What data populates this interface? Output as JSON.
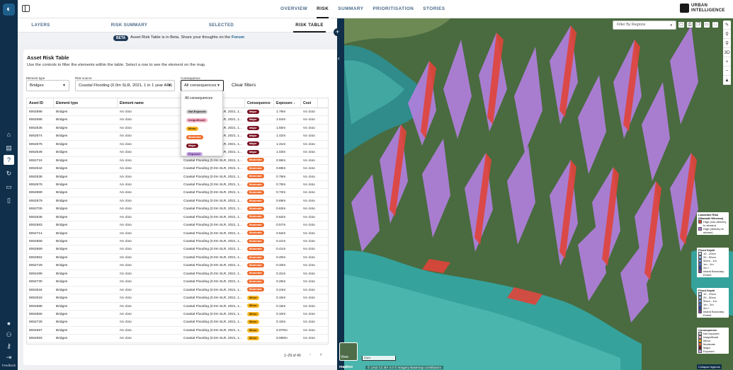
{
  "nav": {
    "items": [
      {
        "label": "OVERVIEW",
        "active": false
      },
      {
        "label": "RISK",
        "active": true
      },
      {
        "label": "SUMMARY",
        "active": false
      },
      {
        "label": "PRIORITISATION",
        "active": false
      },
      {
        "label": "STORIES",
        "active": false
      }
    ],
    "brand_line1": "URBAN",
    "brand_line2": "INTELLIGENCE"
  },
  "subtabs": [
    {
      "label": "LAYERS",
      "active": false
    },
    {
      "label": "RISK SUMMARY",
      "active": false
    },
    {
      "label": "SELECTED",
      "active": false
    },
    {
      "label": "RISK TABLE",
      "active": true
    }
  ],
  "beta": {
    "badge": "BETA",
    "message": "Asset Risk Table is in Beta. Share your thoughts on the ",
    "link": "Forum"
  },
  "card": {
    "title": "Asset Risk Table",
    "description": "Use the controls to filter the elements within the table. Select a row to see the element on the map."
  },
  "filters": {
    "element_type_label": "Element type",
    "element_type_value": "Bridges",
    "risk_source_label": "Risk source",
    "risk_source_value": "Coastal Flooding (0.0m SLR, 2021, 1 in 1 year ARI)",
    "consequence_label": "Consequence",
    "consequence_value": "All consequences",
    "clear_label": "Clear filters"
  },
  "dropdown": {
    "options": [
      "All consequences",
      "Not Exposed",
      "Insignificant",
      "Minor",
      "Moderate",
      "Major",
      "Exposed"
    ]
  },
  "table": {
    "headers": [
      "Asset ID",
      "Element type",
      "Element name",
      "Risk source",
      "Consequence",
      "Exposure ↓",
      "Cost"
    ],
    "rows": [
      [
        "6062598",
        "Bridges",
        "No data",
        "Coastal Flooding (0.0m SLR, 2021, 1...",
        "Major",
        "1.79m",
        "No data"
      ],
      [
        "6062695",
        "Bridges",
        "No data",
        "Coastal Flooding (0.0m SLR, 2021, 1...",
        "Major",
        "1.64m",
        "No data"
      ],
      [
        "6062535",
        "Bridges",
        "No data",
        "Coastal Flooding (0.0m SLR, 2021, 1...",
        "Major",
        "1.55m",
        "No data"
      ],
      [
        "6062674",
        "Bridges",
        "No data",
        "Coastal Flooding (0.0m SLR, 2021, 1...",
        "Major",
        "1.42m",
        "No data"
      ],
      [
        "6062675",
        "Bridges",
        "No data",
        "Coastal Flooding (0.0m SLR, 2021, 1...",
        "Major",
        "1.31m",
        "No data"
      ],
      [
        "6062539",
        "Bridges",
        "No data",
        "Coastal Flooding (0.0m SLR, 2021, 1...",
        "Major",
        "1.03m",
        "No data"
      ],
      [
        "6062724",
        "Bridges",
        "No data",
        "Coastal Flooding (0.0m SLR, 2021, 1...",
        "Moderate",
        "0.96m",
        "No data"
      ],
      [
        "6062542",
        "Bridges",
        "No data",
        "Coastal Flooding (0.0m SLR, 2021, 1...",
        "Moderate",
        "0.88m",
        "No data"
      ],
      [
        "6062538",
        "Bridges",
        "No data",
        "Coastal Flooding (0.0m SLR, 2021, 1...",
        "Moderate",
        "0.79m",
        "No data"
      ],
      [
        "6062678",
        "Bridges",
        "No data",
        "Coastal Flooding (0.0m SLR, 2021, 1...",
        "Moderate",
        "0.76m",
        "No data"
      ],
      [
        "6062689",
        "Bridges",
        "No data",
        "Coastal Flooding (0.0m SLR, 2021, 1...",
        "Moderate",
        "0.73m",
        "No data"
      ],
      [
        "6062679",
        "Bridges",
        "No data",
        "Coastal Flooding (0.0m SLR, 2021, 1...",
        "Moderate",
        "0.69m",
        "No data"
      ],
      [
        "6062705",
        "Bridges",
        "No data",
        "Coastal Flooding (0.0m SLR, 2021, 1...",
        "Moderate",
        "0.63m",
        "No data"
      ],
      [
        "6062536",
        "Bridges",
        "No data",
        "Coastal Flooding (0.0m SLR, 2021, 1...",
        "Moderate",
        "0.62m",
        "No data"
      ],
      [
        "6062683",
        "Bridges",
        "No data",
        "Coastal Flooding (0.0m SLR, 2021, 1...",
        "Moderate",
        "0.57m",
        "No data"
      ],
      [
        "6062714",
        "Bridges",
        "No data",
        "Coastal Flooding (0.0m SLR, 2021, 1...",
        "Moderate",
        "0.52m",
        "No data"
      ],
      [
        "6062658",
        "Bridges",
        "No data",
        "Coastal Flooding (0.0m SLR, 2021, 1...",
        "Moderate",
        "0.41m",
        "No data"
      ],
      [
        "6062659",
        "Bridges",
        "No data",
        "Coastal Flooding (0.0m SLR, 2021, 1...",
        "Moderate",
        "0.41m",
        "No data"
      ],
      [
        "6062662",
        "Bridges",
        "No data",
        "Coastal Flooding (0.0m SLR, 2021, 1...",
        "Moderate",
        "0.40m",
        "No data"
      ],
      [
        "6062729",
        "Bridges",
        "No data",
        "Coastal Flooding (0.0m SLR, 2021, 1...",
        "Moderate",
        "0.33m",
        "No data"
      ],
      [
        "6062489",
        "Bridges",
        "No data",
        "Coastal Flooding (0.0m SLR, 2021, 1...",
        "Moderate",
        "0.31m",
        "No data"
      ],
      [
        "6062730",
        "Bridges",
        "No data",
        "Coastal Flooding (0.0m SLR, 2021, 1...",
        "Moderate",
        "0.26m",
        "No data"
      ],
      [
        "6062534",
        "Bridges",
        "No data",
        "Coastal Flooding (0.0m SLR, 2021, 1...",
        "Moderate",
        "0.24m",
        "No data"
      ],
      [
        "6062518",
        "Bridges",
        "No data",
        "Coastal Flooding (0.0m SLR, 2021, 1...",
        "Minor",
        "0.15m",
        "No data"
      ],
      [
        "6062688",
        "Bridges",
        "No data",
        "Coastal Flooding (0.0m SLR, 2021, 1...",
        "Minor",
        "0.15m",
        "No data"
      ],
      [
        "6062656",
        "Bridges",
        "No data",
        "Coastal Flooding (0.0m SLR, 2021, 1...",
        "Minor",
        "0.10m",
        "No data"
      ],
      [
        "6062728",
        "Bridges",
        "No data",
        "Coastal Flooding (0.0m SLR, 2021, 1...",
        "Minor",
        "0.10m",
        "No data"
      ],
      [
        "6062597",
        "Bridges",
        "No data",
        "Coastal Flooding (0.0m SLR, 2021, 1...",
        "Minor",
        "0.070m",
        "No data"
      ],
      [
        "6062593",
        "Bridges",
        "No data",
        "Coastal Flooding (0.0m SLR, 2021, 1...",
        "Minor",
        "0.060m",
        "No data"
      ]
    ],
    "pagination": "1–29 of 40"
  },
  "map": {
    "filter_placeholder": "Filter By Regions",
    "mode_3d": "3D",
    "view_label": "View",
    "scale": "3 km",
    "mapbox": "mapbox",
    "attribution": "© LINZ CC BY 4.0 © Imagery Basemap contributors",
    "collapse_legends": "Collapse legends",
    "legends": [
      {
        "title": "Landslide Risk (Manaaki Whenua)",
        "items": [
          {
            "label": "High (non-delivery to stream)",
            "color": "#e8443a"
          },
          {
            "label": "High (delivery to stream)",
            "color": "#b079e0"
          }
        ]
      },
      {
        "title": "Flood Depth",
        "items": [
          {
            "label": "10 - 20cm",
            "color": "#c9dcf7"
          },
          {
            "label": "20 - 50cm",
            "color": "#9fc0f0"
          },
          {
            "label": "50cm - 1m",
            "color": "#6f9be3"
          },
          {
            "label": "1m - 2m",
            "color": "#4a6fd0"
          },
          {
            "label": "2m +",
            "color": "#2a3fa8"
          },
          {
            "label": "Inland Boundary Extent",
            "color": "#7b3fa0"
          }
        ]
      },
      {
        "title": "Flood Depth",
        "items": [
          {
            "label": "10 - 20cm",
            "color": "#c9dcf7"
          },
          {
            "label": "20 - 50cm",
            "color": "#9fc0f0"
          },
          {
            "label": "50cm - 1m",
            "color": "#6f9be3"
          },
          {
            "label": "1m - 2m",
            "color": "#4a6fd0"
          },
          {
            "label": "2m +",
            "color": "#2a3fa8"
          },
          {
            "label": "Inland Boundary Extent",
            "color": "#7b3fa0"
          }
        ]
      },
      {
        "title": "Consequence",
        "items": [
          {
            "label": "Not exposed",
            "color": "#cfcfcf"
          },
          {
            "label": "Insignificant",
            "color": "#f7b3c7"
          },
          {
            "label": "Minor",
            "color": "#f7b31c"
          },
          {
            "label": "Moderate",
            "color": "#f06a2a"
          },
          {
            "label": "Major",
            "color": "#7a0f1e"
          },
          {
            "label": "Exposed",
            "color": "#c9a9e6"
          }
        ]
      }
    ]
  },
  "feedback": "Feedback"
}
